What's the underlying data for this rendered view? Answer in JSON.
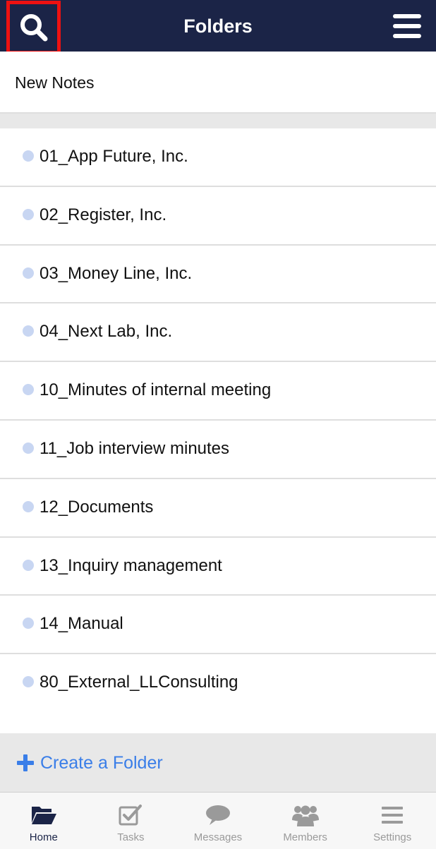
{
  "header": {
    "title": "Folders",
    "search_icon": "search-icon",
    "menu_icon": "hamburger-menu-icon"
  },
  "new_notes": {
    "label": "New Notes"
  },
  "folders": [
    {
      "label": "01_App Future, Inc."
    },
    {
      "label": "02_Register, Inc."
    },
    {
      "label": "03_Money Line, Inc."
    },
    {
      "label": "04_Next Lab, Inc."
    },
    {
      "label": "10_Minutes of internal meeting"
    },
    {
      "label": "11_Job interview minutes"
    },
    {
      "label": "12_Documents"
    },
    {
      "label": "13_Inquiry management"
    },
    {
      "label": "14_Manual"
    },
    {
      "label": "80_External_LLConsulting"
    }
  ],
  "create_folder": {
    "label": "Create a Folder",
    "icon": "plus-icon"
  },
  "tabbar": {
    "tabs": [
      {
        "label": "Home",
        "icon": "folder-open-icon",
        "active": true
      },
      {
        "label": "Tasks",
        "icon": "checkbox-icon",
        "active": false
      },
      {
        "label": "Messages",
        "icon": "speech-bubble-icon",
        "active": false
      },
      {
        "label": "Members",
        "icon": "people-icon",
        "active": false
      },
      {
        "label": "Settings",
        "icon": "list-icon",
        "active": false
      }
    ]
  },
  "colors": {
    "header_bg": "#1b2447",
    "highlight_border": "#ee1111",
    "accent_blue": "#3a7ee8",
    "folder_dot": "#c8d6f2",
    "tab_inactive": "#9a9a9a"
  }
}
